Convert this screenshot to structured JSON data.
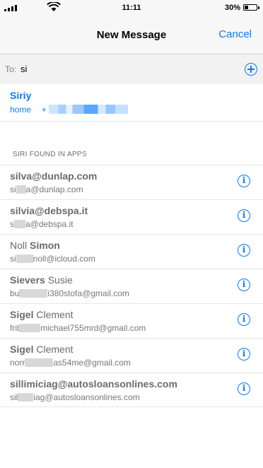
{
  "status_bar": {
    "time": "11:11",
    "battery": "30%",
    "battery_level": 0.3
  },
  "nav": {
    "title": "New Message",
    "cancel": "Cancel"
  },
  "to": {
    "label": "To:",
    "value": "si"
  },
  "suggestion": {
    "name": "Siriy",
    "label": "home",
    "prefix": "+"
  },
  "section_header": "SIRI FOUND IN APPS",
  "results": [
    {
      "title_bold": "silva@dunlap.com",
      "title_rest": "",
      "sub_a": "si",
      "sub_b": "a@dunlap.com"
    },
    {
      "title_bold": "silvia@debspa.it",
      "title_rest": "",
      "sub_a": "s",
      "sub_b": "a@debspa.it"
    },
    {
      "title_rest": "Noll ",
      "title_bold": "Simon",
      "sub_a": "si",
      "sub_b": "noll@icloud.com"
    },
    {
      "title_bold": "Sievers",
      "title_rest": " Susie",
      "sub_a": "bu",
      "sub_b": "i380stofa@gmail.com"
    },
    {
      "title_bold": "Sigel",
      "title_rest": " Clement",
      "sub_a": "frit",
      "sub_b": "michael755mrd@gmail.com"
    },
    {
      "title_bold": "Sigel",
      "title_rest": " Clement",
      "sub_a": "norr",
      "sub_b": "as54me@gmail.com"
    },
    {
      "title_bold": "sillimiciag@autosloansonlines.com",
      "title_rest": "",
      "sub_a": "sil",
      "sub_b": "iag@autosloansonlines.com"
    }
  ]
}
